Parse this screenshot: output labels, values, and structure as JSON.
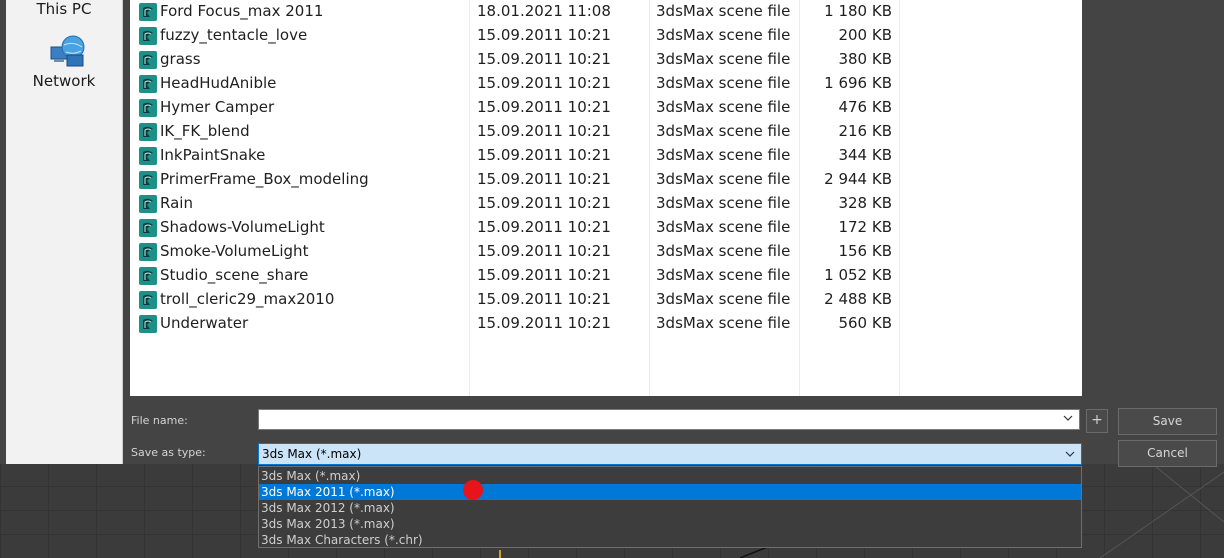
{
  "nav": {
    "this_pc": "This PC",
    "network": "Network"
  },
  "files": [
    {
      "name": "Ford Focus_max 2011",
      "date": "18.01.2021 11:08",
      "type": "3dsMax scene file",
      "size": "1 180 KB"
    },
    {
      "name": "fuzzy_tentacle_love",
      "date": "15.09.2011 10:21",
      "type": "3dsMax scene file",
      "size": "200 KB"
    },
    {
      "name": "grass",
      "date": "15.09.2011 10:21",
      "type": "3dsMax scene file",
      "size": "380 KB"
    },
    {
      "name": "HeadHudAnible",
      "date": "15.09.2011 10:21",
      "type": "3dsMax scene file",
      "size": "1 696 KB"
    },
    {
      "name": "Hymer Camper",
      "date": "15.09.2011 10:21",
      "type": "3dsMax scene file",
      "size": "476 KB"
    },
    {
      "name": "IK_FK_blend",
      "date": "15.09.2011 10:21",
      "type": "3dsMax scene file",
      "size": "216 KB"
    },
    {
      "name": "InkPaintSnake",
      "date": "15.09.2011 10:21",
      "type": "3dsMax scene file",
      "size": "344 KB"
    },
    {
      "name": "PrimerFrame_Box_modeling",
      "date": "15.09.2011 10:21",
      "type": "3dsMax scene file",
      "size": "2 944 KB"
    },
    {
      "name": "Rain",
      "date": "15.09.2011 10:21",
      "type": "3dsMax scene file",
      "size": "328 KB"
    },
    {
      "name": "Shadows-VolumeLight",
      "date": "15.09.2011 10:21",
      "type": "3dsMax scene file",
      "size": "172 KB"
    },
    {
      "name": "Smoke-VolumeLight",
      "date": "15.09.2011 10:21",
      "type": "3dsMax scene file",
      "size": "156 KB"
    },
    {
      "name": "Studio_scene_share",
      "date": "15.09.2011 10:21",
      "type": "3dsMax scene file",
      "size": "1 052 KB"
    },
    {
      "name": "troll_cleric29_max2010",
      "date": "15.09.2011 10:21",
      "type": "3dsMax scene file",
      "size": "2 488 KB"
    },
    {
      "name": "Underwater",
      "date": "15.09.2011 10:21",
      "type": "3dsMax scene file",
      "size": "560 KB"
    }
  ],
  "form": {
    "filename_label": "File name:",
    "filename_value": "",
    "saveas_label": "Save as type:",
    "saveas_value": "3ds Max (*.max)",
    "plus_label": "+",
    "save_label": "Save",
    "cancel_label": "Cancel"
  },
  "dropdown_options": [
    {
      "label": "3ds Max (*.max)",
      "selected": false
    },
    {
      "label": "3ds Max 2011 (*.max)",
      "selected": true
    },
    {
      "label": "3ds Max 2012 (*.max)",
      "selected": false
    },
    {
      "label": "3ds Max 2013 (*.max)",
      "selected": false
    },
    {
      "label": "3ds Max Characters (*.chr)",
      "selected": false
    }
  ],
  "colors": {
    "selection": "#0078d7",
    "cursor": "#e8141c",
    "file_icon": "#1f8f8a"
  },
  "icons": {
    "file": "3dsmax-file-icon",
    "network": "network-icon",
    "chevron": "chevron-down-icon"
  }
}
